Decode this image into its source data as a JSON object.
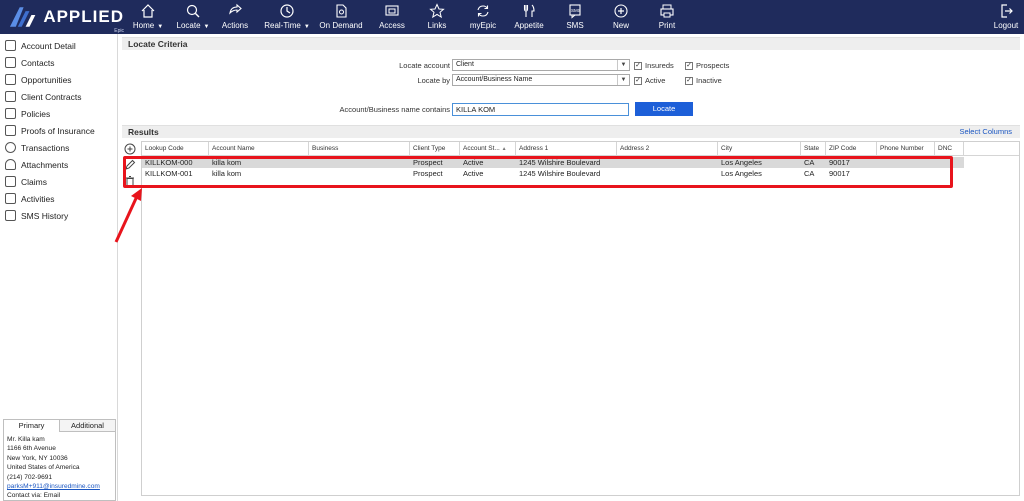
{
  "app": {
    "logo_text": "APPLIED",
    "logo_sub": "Epic"
  },
  "nav": [
    {
      "label": "Home",
      "icon": "home-icon",
      "caret": true
    },
    {
      "label": "Locate",
      "icon": "search-icon",
      "caret": true
    },
    {
      "label": "Actions",
      "icon": "refresh-arrow-icon",
      "caret": false
    },
    {
      "label": "Real-Time",
      "icon": "clock-icon",
      "caret": true
    },
    {
      "label": "On Demand",
      "icon": "document-icon",
      "caret": false
    },
    {
      "label": "Access",
      "icon": "screen-icon",
      "caret": false
    },
    {
      "label": "Links",
      "icon": "star-icon",
      "caret": false
    },
    {
      "label": "myEpic",
      "icon": "sync-icon",
      "caret": false
    },
    {
      "label": "Appetite",
      "icon": "fork-knife-icon",
      "caret": false
    },
    {
      "label": "SMS",
      "icon": "sms-icon",
      "caret": false
    },
    {
      "label": "New",
      "icon": "plus-circle-icon",
      "caret": false
    },
    {
      "label": "Print",
      "icon": "printer-icon",
      "caret": false
    },
    {
      "label": "Logout",
      "icon": "logout-icon",
      "caret": false
    }
  ],
  "sidebar": {
    "items": [
      {
        "label": "Account Detail",
        "icon": "account-detail-icon"
      },
      {
        "label": "Contacts",
        "icon": "contacts-icon"
      },
      {
        "label": "Opportunities",
        "icon": "opportunities-icon"
      },
      {
        "label": "Client Contracts",
        "icon": "handshake-icon"
      },
      {
        "label": "Policies",
        "icon": "policies-icon"
      },
      {
        "label": "Proofs of Insurance",
        "icon": "proofs-icon"
      },
      {
        "label": "Transactions",
        "icon": "dollar-icon"
      },
      {
        "label": "Attachments",
        "icon": "paperclip-icon"
      },
      {
        "label": "Claims",
        "icon": "claims-icon"
      },
      {
        "label": "Activities",
        "icon": "clipboard-icon"
      },
      {
        "label": "SMS History",
        "icon": "sms-history-icon"
      }
    ]
  },
  "contact_card": {
    "tab_primary": "Primary",
    "tab_additional": "Additional",
    "lines": [
      "Mr. Killa kam",
      "1166 6th Avenue",
      "New York, NY  10036",
      "United States of America",
      "(214) 702-9691"
    ],
    "email": "parksM+911@insuredmine.com",
    "contact_via": "Contact via: Email"
  },
  "criteria": {
    "title": "Locate Criteria",
    "locate_account_label": "Locate account",
    "locate_account_value": "Client",
    "locate_by_label": "Locate by",
    "locate_by_value": "Account/Business Name",
    "insureds_label": "Insureds",
    "prospects_label": "Prospects",
    "active_label": "Active",
    "inactive_label": "Inactive",
    "contains_label": "Account/Business name contains",
    "contains_value": "KILLA KOM",
    "locate_button": "Locate",
    "insureds_checked": true,
    "prospects_checked": true,
    "active_checked": true,
    "inactive_checked": true
  },
  "results": {
    "title": "Results",
    "select_columns": "Select Columns",
    "columns": [
      "Lookup Code",
      "Account Name",
      "Business",
      "Client Type",
      "Account St...",
      "Address 1",
      "Address 2",
      "City",
      "State",
      "ZIP Code",
      "Phone Number",
      "DNC"
    ],
    "sort_indicator": "▲",
    "rows": [
      [
        "KILLKOM-000",
        "killa kom",
        "",
        "Prospect",
        "Active",
        "1245 Wilshire Boulevard",
        "",
        "Los Angeles",
        "CA",
        "90017",
        "",
        ""
      ],
      [
        "KILLKOM-001",
        "killa kom",
        "",
        "Prospect",
        "Active",
        "1245 Wilshire Boulevard",
        "",
        "Los Angeles",
        "CA",
        "90017",
        "",
        ""
      ]
    ]
  },
  "colors": {
    "topbar": "#1f2b5c",
    "highlight": "#e8141c",
    "button": "#1d5fd8",
    "link": "#1a56c2"
  }
}
